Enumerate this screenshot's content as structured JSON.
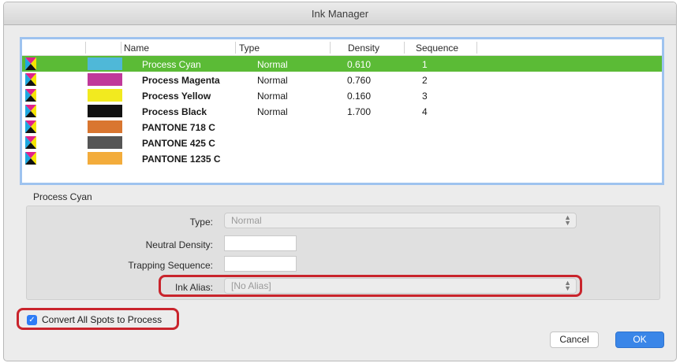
{
  "window": {
    "title": "Ink Manager"
  },
  "ink_list": {
    "columns": [
      "Name",
      "Type",
      "Density",
      "Sequence"
    ],
    "rows": [
      {
        "name": "Process Cyan",
        "type": "Normal",
        "density": "0.610",
        "sequence": "1",
        "swatch": "#4fb8d8",
        "selected": true
      },
      {
        "name": "Process Magenta",
        "type": "Normal",
        "density": "0.760",
        "sequence": "2",
        "swatch": "#c0399a",
        "selected": false
      },
      {
        "name": "Process Yellow",
        "type": "Normal",
        "density": "0.160",
        "sequence": "3",
        "swatch": "#f2ea1f",
        "selected": false
      },
      {
        "name": "Process Black",
        "type": "Normal",
        "density": "1.700",
        "sequence": "4",
        "swatch": "#111111",
        "selected": false
      },
      {
        "name": "PANTONE 718 C",
        "type": "",
        "density": "",
        "sequence": "",
        "swatch": "#d97630",
        "selected": false
      },
      {
        "name": "PANTONE 425 C",
        "type": "",
        "density": "",
        "sequence": "",
        "swatch": "#555555",
        "selected": false
      },
      {
        "name": "PANTONE 1235 C",
        "type": "",
        "density": "",
        "sequence": "",
        "swatch": "#f3ac3b",
        "selected": false
      }
    ],
    "ink_icon": "process-ink-icon"
  },
  "details": {
    "section_title": "Process Cyan",
    "type_label": "Type:",
    "type_value": "Normal",
    "neutral_density_label": "Neutral Density:",
    "neutral_density_value": "",
    "trapping_sequence_label": "Trapping Sequence:",
    "trapping_sequence_value": "",
    "ink_alias_label": "Ink Alias:",
    "ink_alias_value": "[No Alias]"
  },
  "convert_spots": {
    "label": "Convert All Spots to Process",
    "checked": true
  },
  "buttons": {
    "cancel": "Cancel",
    "ok": "OK"
  },
  "colors": {
    "selection": "#5bbb36",
    "accent": "#3a86e8",
    "highlight": "#c9242c"
  }
}
